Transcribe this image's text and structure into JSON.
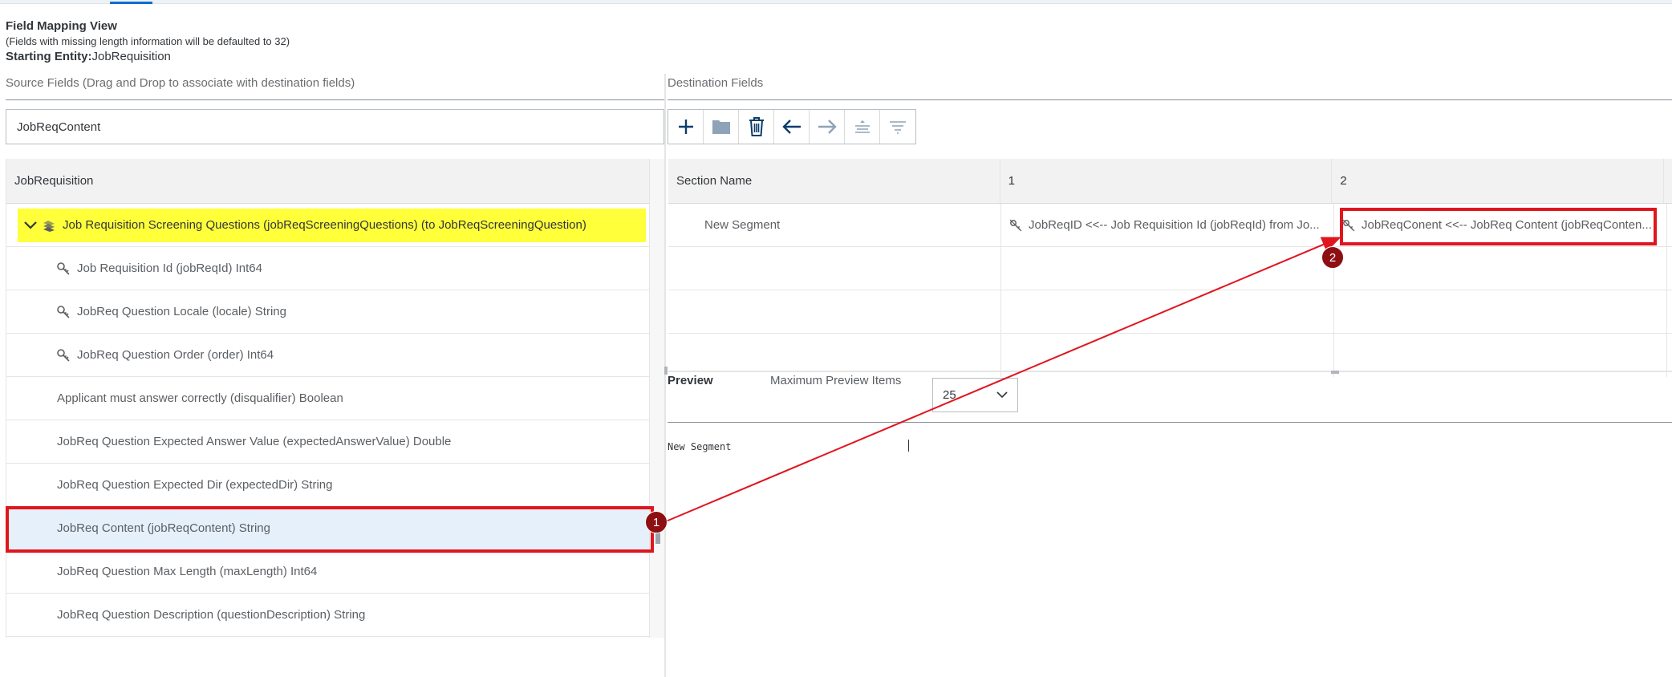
{
  "header": {
    "title": "Field Mapping View",
    "note": "(Fields with missing length information will be defaulted to 32)",
    "starting_entity_label": "Starting Entity:",
    "starting_entity_value": "JobRequisition"
  },
  "source": {
    "panel_label": "Source Fields (Drag and Drop to associate with destination fields)",
    "search_value": "JobReqContent",
    "table_header": "JobRequisition",
    "parent_item": "Job Requisition Screening Questions (jobReqScreeningQuestions) (to JobReqScreeningQuestion)",
    "fields": [
      {
        "label": "Job Requisition Id (jobReqId) Int64",
        "key": true
      },
      {
        "label": "JobReq Question Locale (locale) String",
        "key": true
      },
      {
        "label": "JobReq Question Order (order) Int64",
        "key": true
      },
      {
        "label": "Applicant must answer correctly (disqualifier) Boolean",
        "key": false
      },
      {
        "label": "JobReq Question Expected Answer Value (expectedAnswerValue) Double",
        "key": false
      },
      {
        "label": "JobReq Question Expected Dir (expectedDir) String",
        "key": false
      },
      {
        "label": "JobReq Content (jobReqContent) String",
        "key": false
      },
      {
        "label": "JobReq Question Max Length (maxLength) Int64",
        "key": false
      },
      {
        "label": "JobReq Question Description (questionDescription) String",
        "key": false
      }
    ]
  },
  "destination": {
    "panel_label": "Destination Fields",
    "toolbar_icons": [
      "add-icon",
      "folder-icon",
      "delete-icon",
      "arrow-left-icon",
      "arrow-right-icon",
      "align-top-icon",
      "filter-lines-icon"
    ],
    "columns": [
      "Section Name",
      "1",
      "2"
    ],
    "rows": [
      {
        "section": "New Segment",
        "col1": "JobReqID <<-- Job Requisition Id (jobReqId) from Jo...",
        "col2": "JobReqConent <<-- JobReq Content (jobReqConten..."
      },
      {
        "section": "",
        "col1": "",
        "col2": ""
      },
      {
        "section": "",
        "col1": "",
        "col2": ""
      },
      {
        "section": "",
        "col1": "",
        "col2": ""
      }
    ]
  },
  "preview": {
    "label": "Preview",
    "max_items_label": "Maximum Preview Items",
    "max_items_value": "25",
    "output_text": "New Segment"
  },
  "annotations": {
    "badge1": "1",
    "badge2": "2",
    "color": "#e0161e",
    "badge_color": "#8e0f12"
  },
  "colors": {
    "highlight_yellow": "#ffff3a",
    "selected_row": "#e5f0fa",
    "toolbar_icon_active": "#0a3d6b",
    "toolbar_icon_disabled": "#8fa3b8"
  }
}
